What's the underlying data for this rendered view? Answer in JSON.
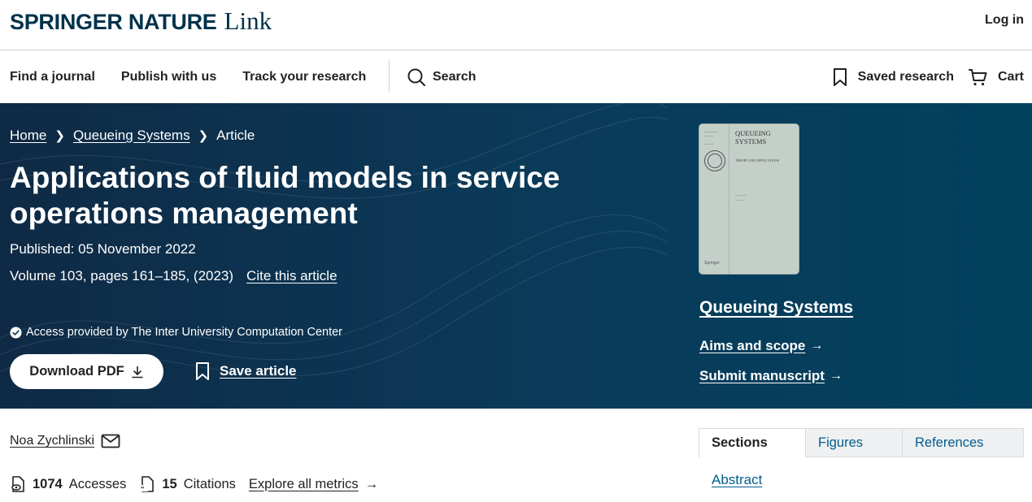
{
  "header": {
    "logo_brand": "SPRINGER NATURE",
    "logo_product": "Link",
    "login_label": "Log in"
  },
  "nav": {
    "items": [
      {
        "label": "Find a journal"
      },
      {
        "label": "Publish with us"
      },
      {
        "label": "Track your research"
      }
    ],
    "search_label": "Search",
    "saved_research_label": "Saved research",
    "cart_label": "Cart"
  },
  "breadcrumb": {
    "home": "Home",
    "journal": "Queueing Systems",
    "current": "Article"
  },
  "article": {
    "title": "Applications of fluid models in service operations management",
    "published": "Published: 05 November 2022",
    "volume": "Volume 103, pages 161–185, (2023)",
    "cite_label": "Cite this article",
    "access": "Access provided by The Inter University Computation Center",
    "download_label": "Download PDF",
    "save_label": "Save article"
  },
  "journal": {
    "name": "Queueing Systems",
    "aims_label": "Aims and scope",
    "submit_label": "Submit manuscript",
    "cover": {
      "title_line1": "QUEUEING",
      "title_line2": "SYSTEMS",
      "subtitle": "THEORY AND APPLICATIONS",
      "publisher": "Springer"
    }
  },
  "author": {
    "name": "Noa Zychlinski"
  },
  "metrics": {
    "accesses_count": "1074",
    "accesses_label": "Accesses",
    "citations_count": "15",
    "citations_label": "Citations",
    "explore_label": "Explore all metrics"
  },
  "tabs": [
    {
      "label": "Sections"
    },
    {
      "label": "Figures"
    },
    {
      "label": "References"
    }
  ],
  "sections": {
    "abstract_label": "Abstract"
  },
  "colors": {
    "brand_navy": "#01324b",
    "hero_bg": "#0a3b5a",
    "link_blue": "#025e8d"
  }
}
